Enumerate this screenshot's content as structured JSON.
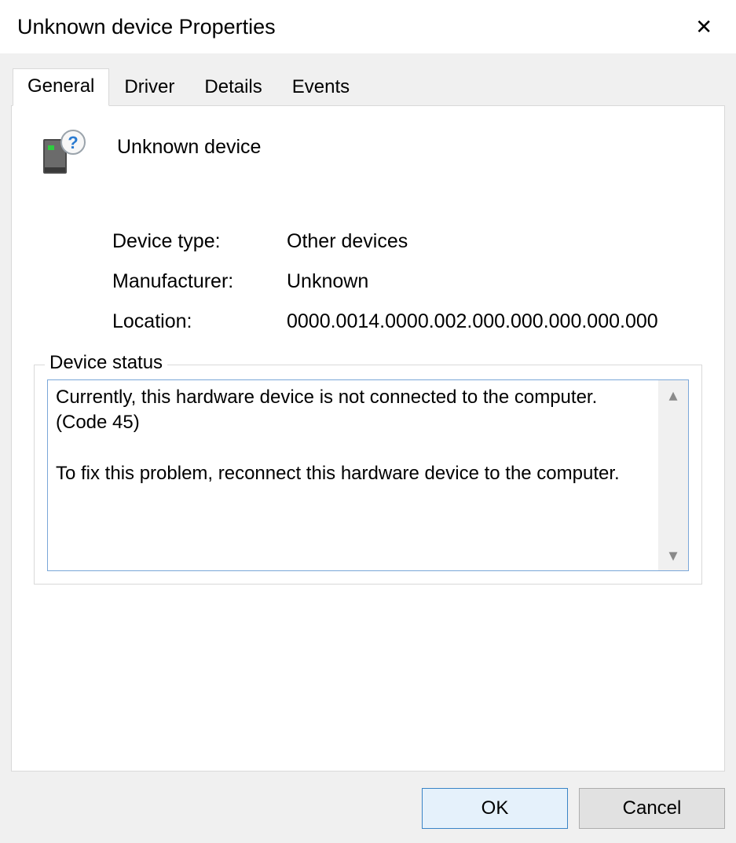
{
  "window": {
    "title": "Unknown device Properties"
  },
  "tabs": [
    {
      "label": "General",
      "active": true
    },
    {
      "label": "Driver",
      "active": false
    },
    {
      "label": "Details",
      "active": false
    },
    {
      "label": "Events",
      "active": false
    }
  ],
  "device": {
    "name": "Unknown device",
    "type_label": "Device type:",
    "type_value": "Other devices",
    "manufacturer_label": "Manufacturer:",
    "manufacturer_value": "Unknown",
    "location_label": "Location:",
    "location_value": "0000.0014.0000.002.000.000.000.000.000"
  },
  "status": {
    "group_label": "Device status",
    "text": "Currently, this hardware device is not connected to the computer. (Code 45)\n\nTo fix this problem, reconnect this hardware device to the computer."
  },
  "buttons": {
    "ok": "OK",
    "cancel": "Cancel"
  }
}
